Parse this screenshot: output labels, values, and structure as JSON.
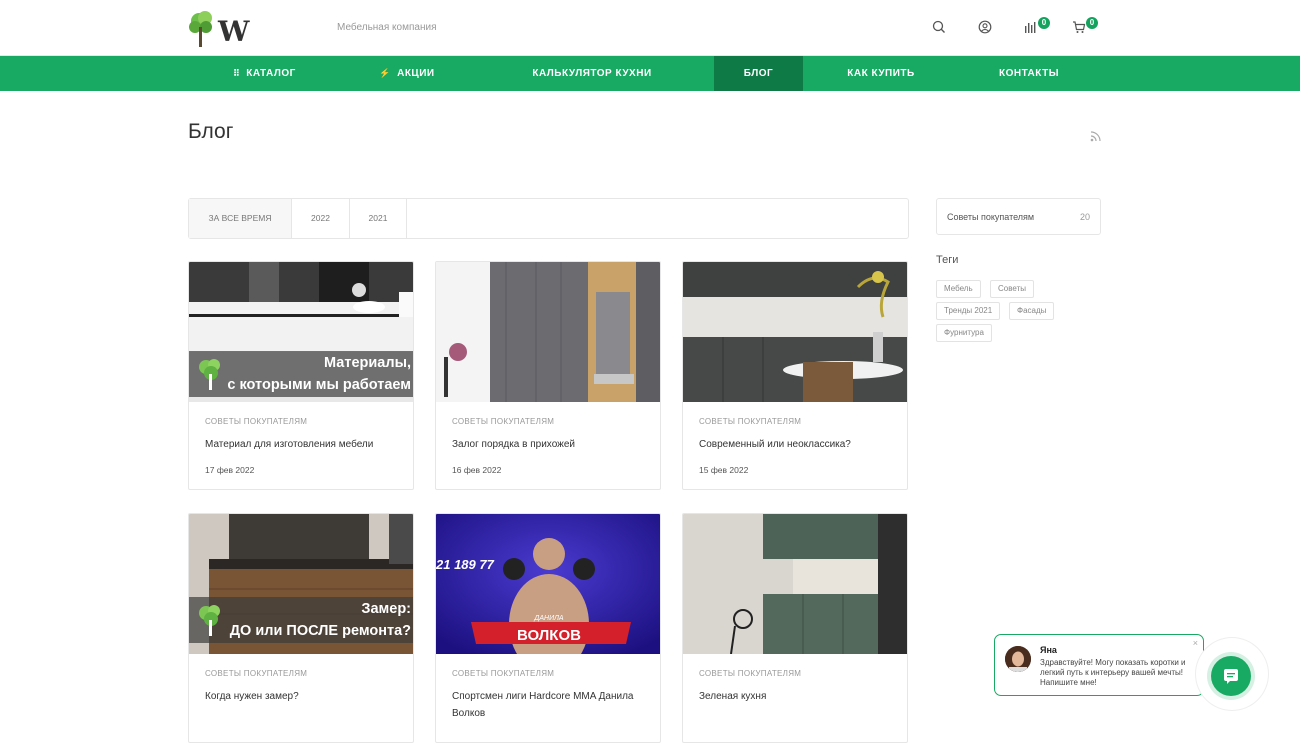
{
  "header": {
    "logo_letter": "W",
    "tagline": "Мебельная компания",
    "compare_count": "0",
    "cart_count": "0"
  },
  "nav": [
    {
      "label": "КАТАЛОГ",
      "icon": "grid-icon"
    },
    {
      "label": "АКЦИИ",
      "icon": "lightning-icon"
    },
    {
      "label": "КАЛЬКУЛЯТОР КУХНИ"
    },
    {
      "label": "БЛОГ"
    },
    {
      "label": "КАК КУПИТЬ"
    },
    {
      "label": "КОНТАКТЫ"
    }
  ],
  "page": {
    "title": "Блог"
  },
  "filters": [
    "ЗА ВСЕ ВРЕМЯ",
    "2022",
    "2021"
  ],
  "posts": [
    {
      "category": "СОВЕТЫ ПОКУПАТЕЛЯМ",
      "title": "Материал для изготовления мебели",
      "date": "17 фев 2022",
      "banner": "Материалы,\nс которыми мы работаем"
    },
    {
      "category": "СОВЕТЫ ПОКУПАТЕЛЯМ",
      "title": "Залог порядка в прихожей",
      "date": "16 фев 2022"
    },
    {
      "category": "СОВЕТЫ ПОКУПАТЕЛЯМ",
      "title": "Современный или неоклассика?",
      "date": "15 фев 2022"
    },
    {
      "category": "СОВЕТЫ ПОКУПАТЕЛЯМ",
      "title": "Когда нужен замер?",
      "banner": "Замер:\nДО или ПОСЛЕ ремонта?"
    },
    {
      "category": "СОВЕТЫ ПОКУПАТЕЛЯМ",
      "title": "Спортсмен лиги Hardcore MMA Данила Волков",
      "poster": {
        "name": "ВОЛКОВ",
        "first": "ДАНИЛА",
        "stats": "21  189  77"
      }
    },
    {
      "category": "СОВЕТЫ ПОКУПАТЕЛЯМ",
      "title": "Зеленая кухня"
    }
  ],
  "sidebar": {
    "section": {
      "label": "Советы покупателям",
      "count": "20"
    },
    "tags_title": "Теги",
    "tags": [
      "Мебель",
      "Советы",
      "Тренды 2021",
      "Фасады",
      "Фурнитура"
    ]
  },
  "chat": {
    "name": "Яна",
    "message": "Здравствуйте! Могу показать коротки и легкий путь к интерьеру вашей мечты! Напишите мне!",
    "close": "×"
  },
  "colors": {
    "brand": "#18a963",
    "nav_active": "#0e7a46"
  }
}
